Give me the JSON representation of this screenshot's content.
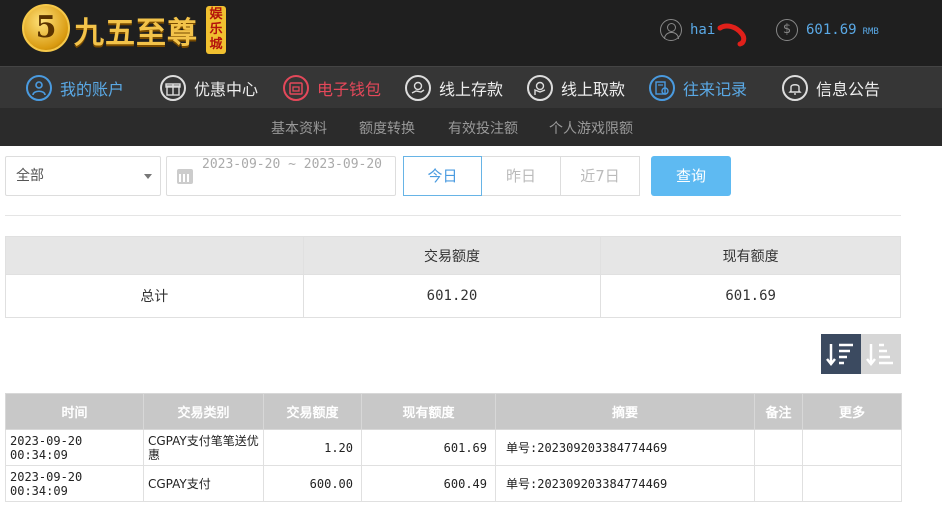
{
  "header": {
    "logo_mark": "5",
    "logo_text": "九五至尊",
    "logo_tag": "娱乐城",
    "username": "hai",
    "balance": "601.69",
    "currency": "RMB"
  },
  "mainnav": {
    "items": [
      {
        "label": "我的账户",
        "icon": "user-icon"
      },
      {
        "label": "优惠中心",
        "icon": "gift-icon"
      },
      {
        "label": "电子钱包",
        "icon": "wallet-icon"
      },
      {
        "label": "线上存款",
        "icon": "deposit-icon"
      },
      {
        "label": "线上取款",
        "icon": "withdraw-icon"
      },
      {
        "label": "往来记录",
        "icon": "records-icon"
      },
      {
        "label": "信息公告",
        "icon": "bell-icon"
      }
    ]
  },
  "subnav": {
    "items": [
      "基本资料",
      "额度转换",
      "有效投注额",
      "个人游戏限额"
    ]
  },
  "filter": {
    "type_selected": "全部",
    "date_range": "2023-09-20 ~ 2023-09-20",
    "today": "今日",
    "yesterday": "昨日",
    "last7": "近7日",
    "query": "查询"
  },
  "summary": {
    "headers": [
      "",
      "交易额度",
      "现有额度"
    ],
    "row": {
      "label": "总计",
      "amount": "601.20",
      "balance": "601.69"
    }
  },
  "records": {
    "headers": [
      "时间",
      "交易类别",
      "交易额度",
      "现有额度",
      "摘要",
      "备注",
      "更多"
    ],
    "rows": [
      {
        "time": "2023-09-20 00:34:09",
        "type": "CGPAY支付笔笔送优惠",
        "amount": "1.20",
        "balance": "601.69",
        "summary": "单号:202309203384774469",
        "note": "",
        "more": ""
      },
      {
        "time": "2023-09-20 00:34:09",
        "type": "CGPAY支付",
        "amount": "600.00",
        "balance": "600.49",
        "summary": "单号:202309203384774469",
        "note": "",
        "more": ""
      }
    ]
  },
  "colors": {
    "accent_blue": "#5aa9e6",
    "accent_red": "#e4485a",
    "query_button": "#5ebaf2"
  }
}
